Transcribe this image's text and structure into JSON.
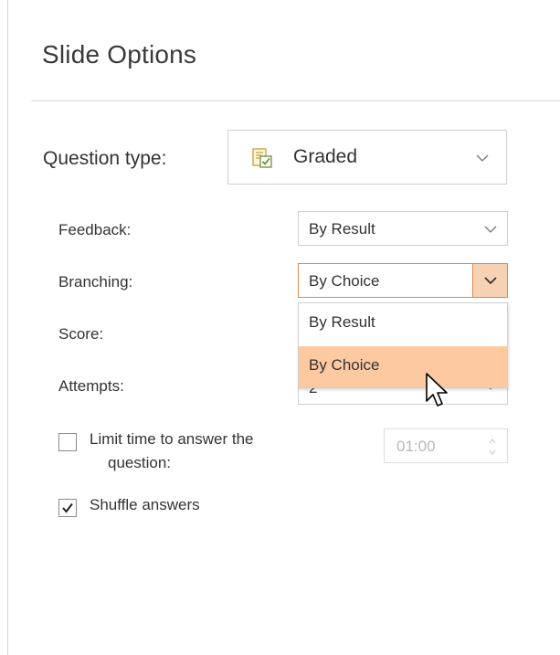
{
  "panel": {
    "title": "Slide Options"
  },
  "question_type": {
    "label": "Question type:",
    "value": "Graded",
    "icon": "graded-question-icon"
  },
  "feedback": {
    "label": "Feedback:",
    "value": "By Result"
  },
  "branching": {
    "label": "Branching:",
    "value": "By Choice",
    "options": [
      "By Result",
      "By Choice"
    ],
    "highlighted": "By Choice"
  },
  "score": {
    "label": "Score:"
  },
  "attempts": {
    "label": "Attempts:",
    "value": "2"
  },
  "time_limit": {
    "label_line1": "Limit time to answer the",
    "label_line2": "question:",
    "checked": false,
    "value": "01:00"
  },
  "shuffle": {
    "label": "Shuffle answers",
    "checked": true
  },
  "colors": {
    "accent": "#d98a52",
    "highlight": "#fcc9a1",
    "button_fill": "#f7d1b4"
  }
}
